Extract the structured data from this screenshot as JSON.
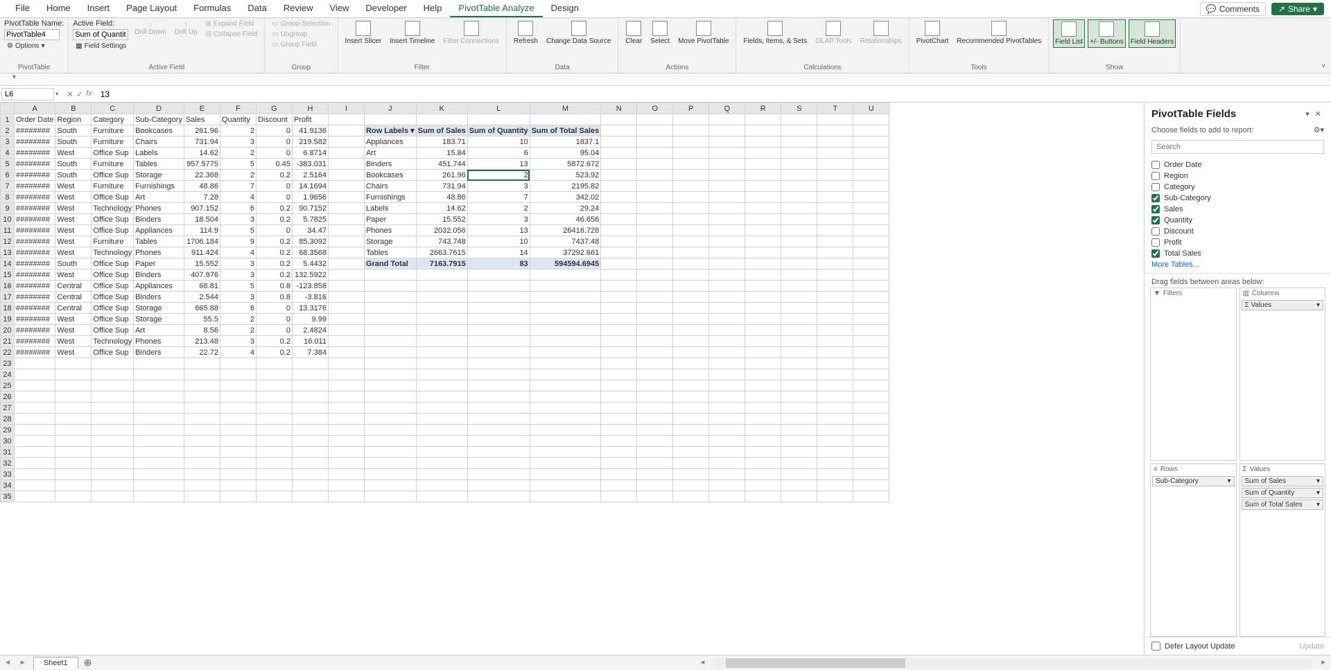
{
  "ribbon_tabs": [
    "File",
    "Home",
    "Insert",
    "Page Layout",
    "Formulas",
    "Data",
    "Review",
    "View",
    "Developer",
    "Help",
    "PivotTable Analyze",
    "Design"
  ],
  "active_tab_index": 10,
  "comments_label": "Comments",
  "share_label": "Share",
  "pivottable_name_label": "PivotTable Name:",
  "pivottable_name_value": "PivotTable4",
  "options_label": "Options",
  "group_pt_label": "PivotTable",
  "active_field_label": "Active Field:",
  "active_field_value": "Sum of Quantity",
  "field_settings_label": "Field Settings",
  "drill_down_label": "Drill Down",
  "drill_up_label": "Drill Up",
  "expand_field_label": "Expand Field",
  "collapse_field_label": "Collapse Field",
  "group_af_label": "Active Field",
  "group_selection_label": "Group Selection",
  "ungroup_label": "Ungroup",
  "group_field_label": "Group Field",
  "group_group_label": "Group",
  "insert_slicer_label": "Insert Slicer",
  "insert_timeline_label": "Insert Timeline",
  "filter_conn_label": "Filter Connections",
  "group_filter_label": "Filter",
  "refresh_label": "Refresh",
  "change_ds_label": "Change Data Source",
  "group_data_label": "Data",
  "clear_label": "Clear",
  "select_label": "Select",
  "move_pt_label": "Move PivotTable",
  "group_actions_label": "Actions",
  "fields_items_label": "Fields, Items, & Sets",
  "olap_label": "OLAP Tools",
  "relationships_label": "Relationships",
  "group_calc_label": "Calculations",
  "pivotchart_label": "PivotChart",
  "rec_pt_label": "Recommended PivotTables",
  "group_tools_label": "Tools",
  "field_list_label": "Field List",
  "pm_buttons_label": "+/- Buttons",
  "field_headers_label": "Field Headers",
  "group_show_label": "Show",
  "name_box": "L6",
  "formula_value": "13",
  "columns": [
    "A",
    "B",
    "C",
    "D",
    "E",
    "F",
    "G",
    "H",
    "I",
    "J",
    "K",
    "L",
    "M",
    "N",
    "O",
    "P",
    "Q",
    "R",
    "S",
    "T",
    "U"
  ],
  "header_row": [
    "Order Date",
    "Region",
    "Category",
    "Sub-Category",
    "Sales",
    "Quantity",
    "Discount",
    "Profit"
  ],
  "data_rows": [
    {
      "a": "########",
      "b": "South",
      "c": "Furniture",
      "d": "Bookcases",
      "e": "261.96",
      "f": "2",
      "g": "0",
      "h": "41.9136"
    },
    {
      "a": "########",
      "b": "South",
      "c": "Furniture",
      "d": "Chairs",
      "e": "731.94",
      "f": "3",
      "g": "0",
      "h": "219.582"
    },
    {
      "a": "########",
      "b": "West",
      "c": "Office Sup",
      "d": "Labels",
      "e": "14.62",
      "f": "2",
      "g": "0",
      "h": "6.8714"
    },
    {
      "a": "########",
      "b": "South",
      "c": "Furniture",
      "d": "Tables",
      "e": "957.5775",
      "f": "5",
      "g": "0.45",
      "h": "-383.031"
    },
    {
      "a": "########",
      "b": "South",
      "c": "Office Sup",
      "d": "Storage",
      "e": "22.368",
      "f": "2",
      "g": "0.2",
      "h": "2.5164"
    },
    {
      "a": "########",
      "b": "West",
      "c": "Furniture",
      "d": "Furnishings",
      "e": "48.86",
      "f": "7",
      "g": "0",
      "h": "14.1694"
    },
    {
      "a": "########",
      "b": "West",
      "c": "Office Sup",
      "d": "Art",
      "e": "7.28",
      "f": "4",
      "g": "0",
      "h": "1.9656"
    },
    {
      "a": "########",
      "b": "West",
      "c": "Technology",
      "d": "Phones",
      "e": "907.152",
      "f": "6",
      "g": "0.2",
      "h": "90.7152"
    },
    {
      "a": "########",
      "b": "West",
      "c": "Office Sup",
      "d": "Binders",
      "e": "18.504",
      "f": "3",
      "g": "0.2",
      "h": "5.7825"
    },
    {
      "a": "########",
      "b": "West",
      "c": "Office Sup",
      "d": "Appliances",
      "e": "114.9",
      "f": "5",
      "g": "0",
      "h": "34.47"
    },
    {
      "a": "########",
      "b": "West",
      "c": "Furniture",
      "d": "Tables",
      "e": "1706.184",
      "f": "9",
      "g": "0.2",
      "h": "85.3092"
    },
    {
      "a": "########",
      "b": "West",
      "c": "Technology",
      "d": "Phones",
      "e": "911.424",
      "f": "4",
      "g": "0.2",
      "h": "68.3568"
    },
    {
      "a": "########",
      "b": "South",
      "c": "Office Sup",
      "d": "Paper",
      "e": "15.552",
      "f": "3",
      "g": "0.2",
      "h": "5.4432"
    },
    {
      "a": "########",
      "b": "West",
      "c": "Office Sup",
      "d": "Binders",
      "e": "407.976",
      "f": "3",
      "g": "0.2",
      "h": "132.5922"
    },
    {
      "a": "########",
      "b": "Central",
      "c": "Office Sup",
      "d": "Appliances",
      "e": "68.81",
      "f": "5",
      "g": "0.8",
      "h": "-123.858"
    },
    {
      "a": "########",
      "b": "Central",
      "c": "Office Sup",
      "d": "Binders",
      "e": "2.544",
      "f": "3",
      "g": "0.8",
      "h": "-3.816"
    },
    {
      "a": "########",
      "b": "Central",
      "c": "Office Sup",
      "d": "Storage",
      "e": "665.88",
      "f": "6",
      "g": "0",
      "h": "13.3176"
    },
    {
      "a": "########",
      "b": "West",
      "c": "Office Sup",
      "d": "Storage",
      "e": "55.5",
      "f": "2",
      "g": "0",
      "h": "9.99"
    },
    {
      "a": "########",
      "b": "West",
      "c": "Office Sup",
      "d": "Art",
      "e": "8.56",
      "f": "2",
      "g": "0",
      "h": "2.4824"
    },
    {
      "a": "########",
      "b": "West",
      "c": "Technology",
      "d": "Phones",
      "e": "213.48",
      "f": "3",
      "g": "0.2",
      "h": "16.011"
    },
    {
      "a": "########",
      "b": "West",
      "c": "Office Sup",
      "d": "Binders",
      "e": "22.72",
      "f": "4",
      "g": "0.2",
      "h": "7.384"
    }
  ],
  "pivot_header": {
    "row_labels": "Row Labels",
    "sum_sales": "Sum of Sales",
    "sum_qty": "Sum of Quantity",
    "sum_total": "Sum of Total Sales"
  },
  "pivot_rows": [
    {
      "cat": "Appliances",
      "sales": "183.71",
      "qty": "10",
      "total": "1837.1"
    },
    {
      "cat": "Art",
      "sales": "15.84",
      "qty": "6",
      "total": "95.04"
    },
    {
      "cat": "Binders",
      "sales": "451.744",
      "qty": "13",
      "total": "5872.672"
    },
    {
      "cat": "Bookcases",
      "sales": "261.96",
      "qty": "2",
      "total": "523.92"
    },
    {
      "cat": "Chairs",
      "sales": "731.94",
      "qty": "3",
      "total": "2195.82"
    },
    {
      "cat": "Furnishings",
      "sales": "48.86",
      "qty": "7",
      "total": "342.02"
    },
    {
      "cat": "Labels",
      "sales": "14.62",
      "qty": "2",
      "total": "29.24"
    },
    {
      "cat": "Paper",
      "sales": "15.552",
      "qty": "3",
      "total": "46.656"
    },
    {
      "cat": "Phones",
      "sales": "2032.056",
      "qty": "13",
      "total": "26416.728"
    },
    {
      "cat": "Storage",
      "sales": "743.748",
      "qty": "10",
      "total": "7437.48"
    },
    {
      "cat": "Tables",
      "sales": "2663.7615",
      "qty": "14",
      "total": "37292.661"
    }
  ],
  "pivot_total": {
    "label": "Grand Total",
    "sales": "7163.7915",
    "qty": "83",
    "total": "594594.6945"
  },
  "pane": {
    "title": "PivotTable Fields",
    "choose_label": "Choose fields to add to report:",
    "search_placeholder": "Search",
    "fields": [
      {
        "name": "Order Date",
        "checked": false
      },
      {
        "name": "Region",
        "checked": false
      },
      {
        "name": "Category",
        "checked": false
      },
      {
        "name": "Sub-Category",
        "checked": true
      },
      {
        "name": "Sales",
        "checked": true
      },
      {
        "name": "Quantity",
        "checked": true
      },
      {
        "name": "Discount",
        "checked": false
      },
      {
        "name": "Profit",
        "checked": false
      },
      {
        "name": "Total Sales",
        "checked": true
      }
    ],
    "more_tables": "More Tables...",
    "drag_label": "Drag fields between areas below:",
    "filters_title": "Filters",
    "columns_title": "Columns",
    "rows_title": "Rows",
    "values_title": "Values",
    "columns_items": [
      "Σ Values"
    ],
    "rows_items": [
      "Sub-Category"
    ],
    "values_items": [
      "Sum of Sales",
      "Sum of Quantity",
      "Sum of Total Sales"
    ],
    "defer_label": "Defer Layout Update",
    "update_label": "Update"
  },
  "sheet_tab": "Sheet1"
}
